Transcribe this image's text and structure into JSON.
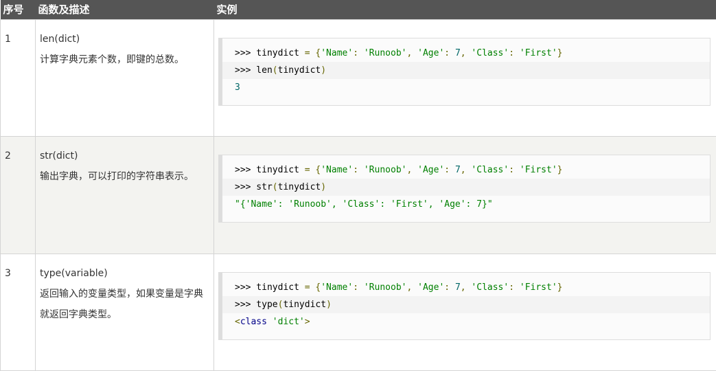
{
  "header": {
    "col_num": "序号",
    "col_func": "函数及描述",
    "col_example": "实例"
  },
  "rows": [
    {
      "num": "1",
      "func": "len(dict)",
      "desc": "计算字典元素个数，即键的总数。",
      "code": [
        ">>> tinydict = {'Name': 'Runoob', 'Age': 7, 'Class': 'First'}",
        ">>> len(tinydict)",
        "3"
      ]
    },
    {
      "num": "2",
      "func": "str(dict)",
      "desc": "输出字典，可以打印的字符串表示。",
      "code": [
        ">>> tinydict = {'Name': 'Runoob', 'Age': 7, 'Class': 'First'}",
        ">>> str(tinydict)",
        "\"{'Name': 'Runoob', 'Class': 'First', 'Age': 7}\""
      ]
    },
    {
      "num": "3",
      "func": "type(variable)",
      "desc": "返回输入的变量类型，如果变量是字典就返回字典类型。",
      "code": [
        ">>> tinydict = {'Name': 'Runoob', 'Age': 7, 'Class': 'First'}",
        ">>> type(tinydict)",
        "<class 'dict'>"
      ]
    }
  ],
  "colors": {
    "header_bg": "#555555",
    "header_text": "#ffffff",
    "alt_row_bg": "#f3f3f0",
    "string_token": "#008000",
    "number_token": "#006666",
    "keyword_token": "#000088"
  }
}
